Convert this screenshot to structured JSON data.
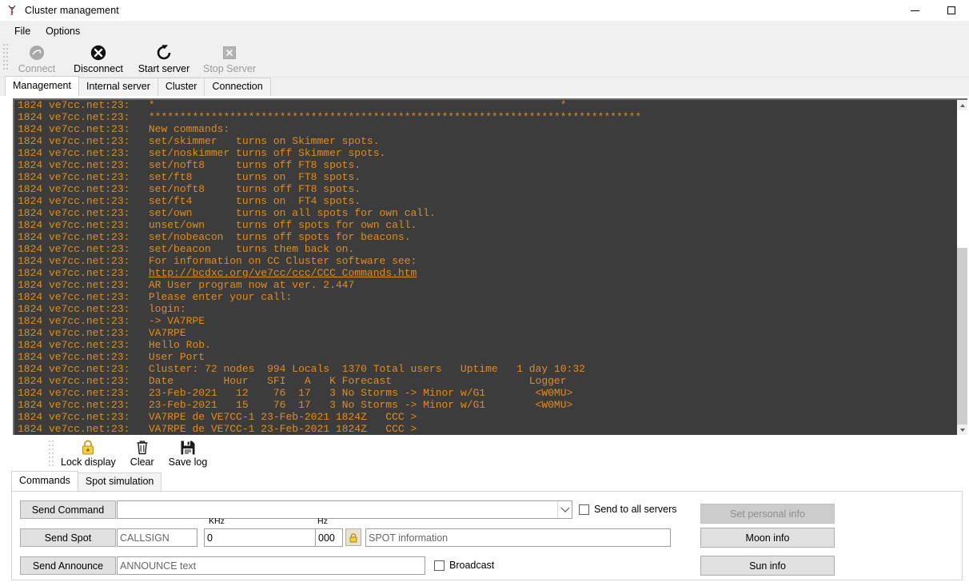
{
  "window": {
    "title": "Cluster management",
    "app_icon": "antenna-icon",
    "minimize_label": "Minimize",
    "maximize_label": "Maximize"
  },
  "menu": {
    "items": [
      {
        "label": "File",
        "name": "menu-file"
      },
      {
        "label": "Options",
        "name": "menu-options"
      }
    ]
  },
  "toolbar": {
    "buttons": [
      {
        "label": "Connect",
        "icon": "connect-icon",
        "enabled": false
      },
      {
        "label": "Disconnect",
        "icon": "disconnect-icon",
        "enabled": true
      },
      {
        "label": "Start server",
        "icon": "start-server-icon",
        "enabled": true
      },
      {
        "label": "Stop Server",
        "icon": "stop-server-icon",
        "enabled": false
      }
    ]
  },
  "tabs": {
    "items": [
      {
        "label": "Management",
        "active": true
      },
      {
        "label": "Internal server",
        "active": false
      },
      {
        "label": "Cluster",
        "active": false
      },
      {
        "label": "Connection",
        "active": false
      }
    ]
  },
  "console": {
    "prefix": "1824 ve7cc.net:23:",
    "colors": {
      "text": "#e28c1c",
      "background": "#3c3c3c"
    },
    "lines": [
      {
        "body": "*                                                                 *"
      },
      {
        "body": "*******************************************************************************"
      },
      {
        "body": "New commands:"
      },
      {
        "body": "set/skimmer   turns on Skimmer spots."
      },
      {
        "body": "set/noskimmer turns off Skimmer spots."
      },
      {
        "body": "set/noft8     turns off FT8 spots."
      },
      {
        "body": "set/ft8       turns on  FT8 spots."
      },
      {
        "body": "set/noft8     turns off FT8 spots."
      },
      {
        "body": "set/ft4       turns on  FT4 spots."
      },
      {
        "body": "set/own       turns on all spots for own call."
      },
      {
        "body": "unset/own     turns off spots for own call."
      },
      {
        "body": "set/nobeacon  turns off spots for beacons."
      },
      {
        "body": "set/beacon    turns them back on."
      },
      {
        "body": "For information on CC Cluster software see:"
      },
      {
        "body": "http://bcdxc.org/ve7cc/ccc/CCC Commands.htm",
        "link": true
      },
      {
        "body": "AR User program now at ver. 2.447"
      },
      {
        "body": "Please enter your call:"
      },
      {
        "body": "login:"
      },
      {
        "body": "-> VA7RPE"
      },
      {
        "body": "VA7RPE"
      },
      {
        "body": "Hello Rob."
      },
      {
        "body": "User Port"
      },
      {
        "body": "Cluster: 72 nodes  994 Locals  1370 Total users   Uptime   1 day 10:32"
      },
      {
        "body": "Date        Hour   SFI   A   K Forecast                      Logger"
      },
      {
        "body": "23-Feb-2021   12    76  17   3 No Storms -> Minor w/G1        <W0MU>"
      },
      {
        "body": "23-Feb-2021   15    76  17   3 No Storms -> Minor w/G1        <W0MU>"
      },
      {
        "body": "VA7RPE de VE7CC-1 23-Feb-2021 1824Z   CCC >"
      },
      {
        "body": "VA7RPE de VE7CC-1 23-Feb-2021 1824Z   CCC >"
      }
    ],
    "scrollbar": {
      "up_arrow": "scroll-up-arrow",
      "down_arrow": "scroll-down-arrow"
    }
  },
  "log_toolbar": {
    "buttons": [
      {
        "label": "Lock display",
        "icon": "lock-icon"
      },
      {
        "label": "Clear",
        "icon": "trash-icon"
      },
      {
        "label": "Save log",
        "icon": "save-icon"
      }
    ]
  },
  "bottom_tabs": {
    "items": [
      {
        "label": "Commands",
        "active": true
      },
      {
        "label": "Spot simulation",
        "active": false
      }
    ]
  },
  "commands": {
    "send_command_label": "Send Command",
    "command_value": "",
    "send_to_all_servers_label": "Send to all servers",
    "send_to_all_servers_checked": false,
    "send_spot_label": "Send Spot",
    "callsign_placeholder": "CALLSIGN",
    "callsign_value": "",
    "khz_label": "KHz",
    "khz_value": "0",
    "hz_label": "Hz",
    "hz_value": "000",
    "lock_icon": "lock-icon",
    "spot_info_placeholder": "SPOT information",
    "spot_info_value": "",
    "send_announce_label": "Send Announce",
    "announce_placeholder": "ANNOUNCE text",
    "announce_value": "",
    "broadcast_label": "Broadcast",
    "broadcast_checked": false,
    "side_buttons": [
      {
        "label": "Set personal info",
        "enabled": false
      },
      {
        "label": "Moon info",
        "enabled": true
      },
      {
        "label": "Sun info",
        "enabled": true
      }
    ]
  }
}
